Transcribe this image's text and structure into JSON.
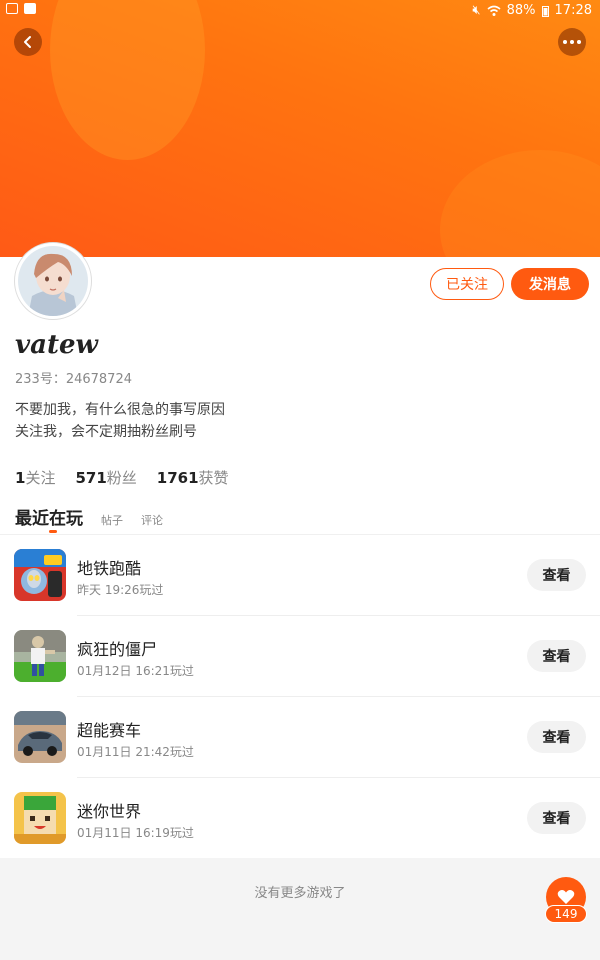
{
  "status_bar": {
    "battery": "88%",
    "time": "17:28"
  },
  "profile": {
    "username": "vatew",
    "id_label": "233号：24678724",
    "bio_lines": [
      "不要加我，有什么很急的事写原因",
      "关注我，会不定期抽粉丝刷号"
    ],
    "follow_button": "已关注",
    "message_button": "发消息"
  },
  "stats": {
    "following": {
      "num": "1",
      "label": "关注"
    },
    "followers": {
      "num": "571",
      "label": "粉丝"
    },
    "likes": {
      "num": "1761",
      "label": "获赞"
    }
  },
  "tabs": {
    "active": "最近在玩",
    "posts": "帖子",
    "comments": "评论"
  },
  "games": [
    {
      "name": "地铁跑酷",
      "time": "昨天  19:26玩过",
      "action": "查看",
      "icon": "subway-surfers-icon"
    },
    {
      "name": "疯狂的僵尸",
      "time": "01月12日  16:21玩过",
      "action": "查看",
      "icon": "crazy-zombie-icon"
    },
    {
      "name": "超能赛车",
      "time": "01月11日  21:42玩过",
      "action": "查看",
      "icon": "super-racing-icon"
    },
    {
      "name": "迷你世界",
      "time": "01月11日  16:19玩过",
      "action": "查看",
      "icon": "mini-world-icon"
    }
  ],
  "footer": {
    "message": "没有更多游戏了"
  },
  "like_fab": {
    "count": "149"
  },
  "colors": {
    "accent": "#ff5a10",
    "banner_top": "#ff8a12",
    "banner_bottom": "#ff5a16"
  }
}
